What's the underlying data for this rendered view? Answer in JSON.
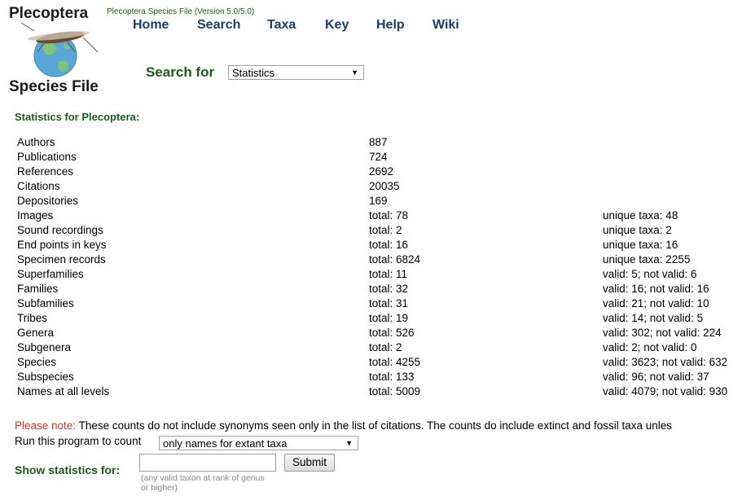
{
  "header": {
    "logo_title": "Plecoptera",
    "logo_subtitle": "Species File",
    "version": "Plecoptera Species File (Version 5.0/5.0)",
    "nav": [
      "Home",
      "Search",
      "Taxa",
      "Key",
      "Help",
      "Wiki"
    ]
  },
  "search": {
    "label": "Search for",
    "selected": "Statistics"
  },
  "stats": {
    "title": "Statistics for Plecoptera:",
    "rows": [
      {
        "label": "Authors",
        "total": "887",
        "extra": ""
      },
      {
        "label": "Publications",
        "total": "724",
        "extra": ""
      },
      {
        "label": "References",
        "total": "2692",
        "extra": ""
      },
      {
        "label": "Citations",
        "total": "20035",
        "extra": ""
      },
      {
        "label": "Depositories",
        "total": "169",
        "extra": ""
      },
      {
        "label": "Images",
        "total": "total: 78",
        "extra": "unique taxa: 48"
      },
      {
        "label": "Sound recordings",
        "total": "total: 2",
        "extra": "unique taxa: 2"
      },
      {
        "label": "End points in keys",
        "total": "total: 16",
        "extra": "unique taxa: 16"
      },
      {
        "label": "Specimen records",
        "total": "total: 6824",
        "extra": "unique taxa: 2255"
      },
      {
        "label": "Superfamilies",
        "total": "total: 11",
        "extra": "valid: 5; not valid: 6"
      },
      {
        "label": "Families",
        "total": "total: 32",
        "extra": "valid: 16; not valid: 16"
      },
      {
        "label": "Subfamilies",
        "total": "total: 31",
        "extra": "valid: 21; not valid: 10"
      },
      {
        "label": "Tribes",
        "total": "total: 19",
        "extra": "valid: 14; not valid: 5"
      },
      {
        "label": "Genera",
        "total": "total: 526",
        "extra": "valid: 302; not valid: 224"
      },
      {
        "label": "Subgenera",
        "total": "total: 2",
        "extra": "valid: 2; not valid: 0"
      },
      {
        "label": "Species",
        "total": "total: 4255",
        "extra": "valid: 3623; not valid: 632"
      },
      {
        "label": "Subspecies",
        "total": "total: 133",
        "extra": "valid: 96; not valid: 37"
      },
      {
        "label": "Names at all levels",
        "total": "total: 5009",
        "extra": "valid: 4079; not valid: 930"
      }
    ]
  },
  "note": {
    "label": "Please note:",
    "text": " These counts do not include synonyms seen only in the list of citations. The counts do include extinct and fossil taxa unles"
  },
  "run": {
    "label": "Run this program to count",
    "selected": "only names for extant taxa"
  },
  "show": {
    "label": "Show statistics for:",
    "input_value": "",
    "hint": "(any valid taxon at rank of genus or higher)",
    "submit_label": "Submit"
  },
  "colors": {
    "accent_green": "#1a5c1a",
    "nav_blue": "#1a3d6b",
    "note_red": "#c0392b"
  },
  "icons": [
    "stonefly-globe-logo-icon",
    "dropdown-arrow-icon"
  ]
}
